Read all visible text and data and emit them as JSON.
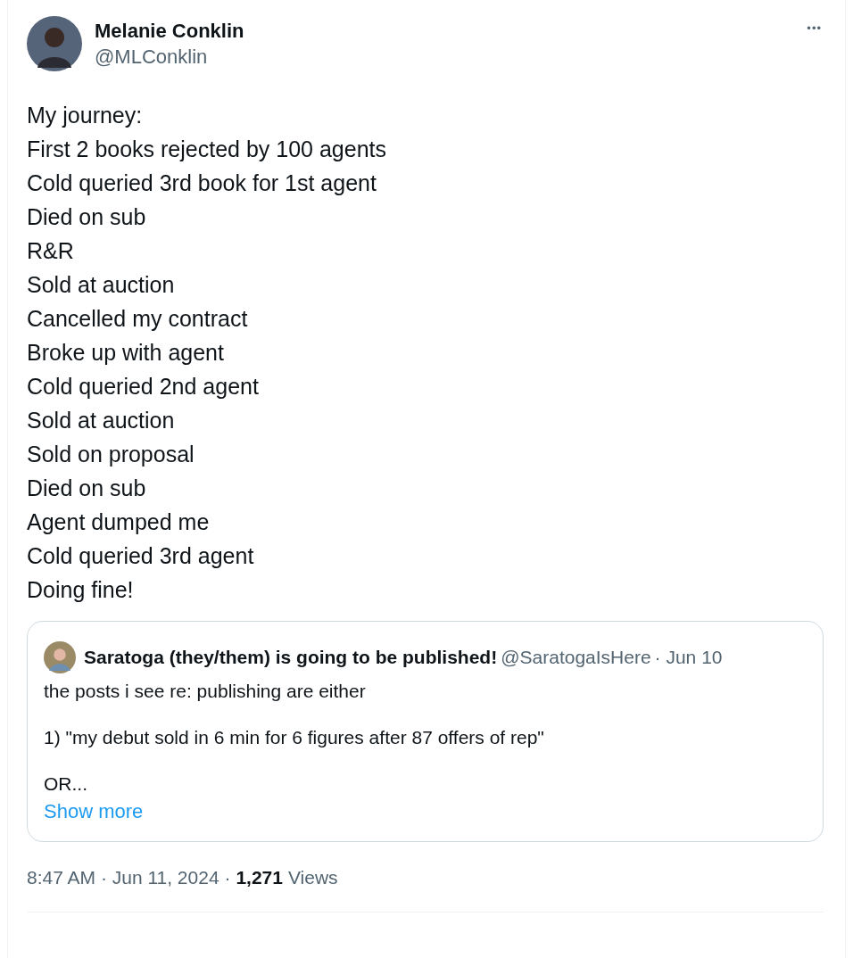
{
  "author": {
    "name": "Melanie Conklin",
    "handle": "@MLConklin"
  },
  "more": "•••",
  "lines": [
    "My journey:",
    "First 2 books rejected by 100 agents",
    "Cold queried 3rd book for 1st agent",
    "Died on sub",
    "R&R",
    "Sold at auction",
    "Cancelled my contract",
    "Broke up with agent",
    "Cold queried 2nd agent",
    "Sold at auction",
    "Sold on proposal",
    "Died on sub",
    "Agent dumped me",
    "Cold queried 3rd agent",
    "Doing fine!"
  ],
  "quote": {
    "name": "Saratoga (they/them) is going to be published!",
    "handle": "@SaratogaIsHere",
    "date": "· Jun 10",
    "paragraphs": [
      "the posts i see re: publishing are either",
      "1) \"my debut sold in 6 min for 6 figures after 87 offers of rep\"",
      "OR..."
    ],
    "show_more": "Show more"
  },
  "footer": {
    "time": "8:47 AM · Jun 11, 2024 ·",
    "views_count": "1,271",
    "views_label": "Views"
  }
}
